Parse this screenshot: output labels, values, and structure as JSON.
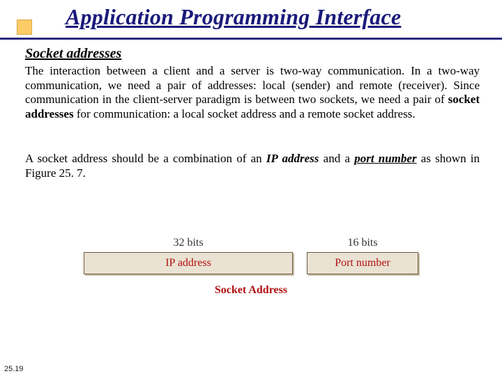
{
  "title": "Application Programming Interface",
  "subtitle": "Socket addresses",
  "para1_parts": {
    "a": "The interaction between a client and a server is two-way communication. In a two-way communication, we need a pair of addresses: local (sender) and remote (receiver). Since communication in the client-server paradigm is between two sockets, we need a pair of ",
    "b": "socket addresses",
    "c": " for communication: a local socket address and a remote socket address."
  },
  "para2_parts": {
    "a": "A socket address should be a combination of an ",
    "b": "IP address",
    "c": " and a ",
    "d": "port number",
    "e": " as shown in Figure 25. 7."
  },
  "figure": {
    "bits_ip": "32 bits",
    "bits_port": "16 bits",
    "ip_label": "IP address",
    "port_label": "Port number",
    "caption": "Socket Address"
  },
  "page_number": "25.19"
}
